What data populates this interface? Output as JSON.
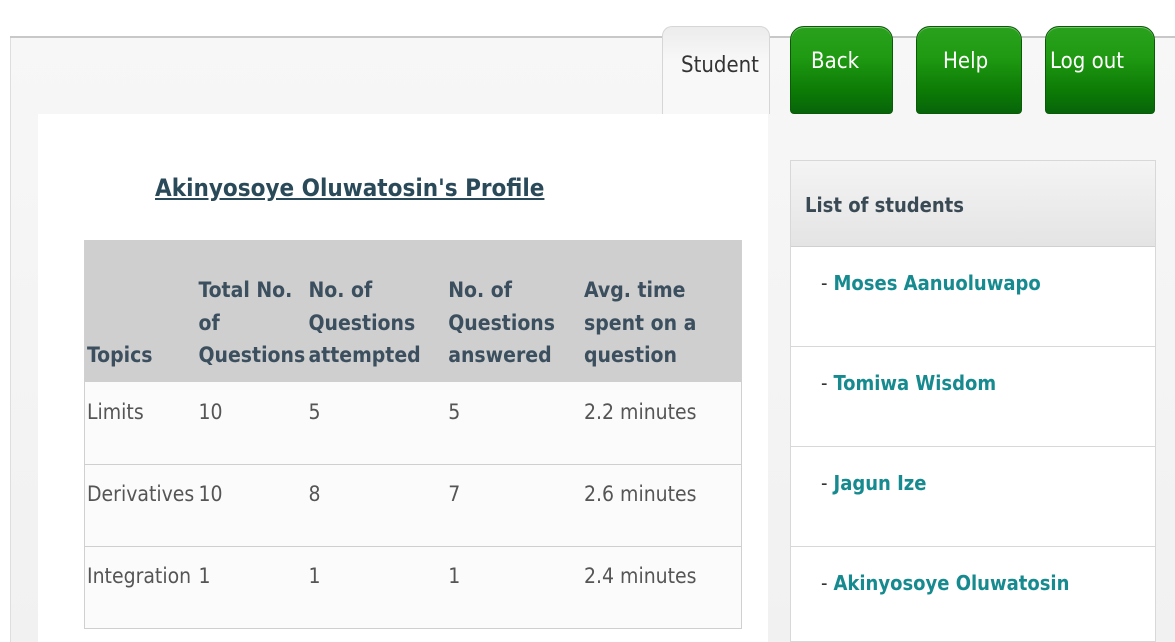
{
  "nav": {
    "student_tab": "Student",
    "back": "Back",
    "help": "Help",
    "logout": "Log out"
  },
  "profile": {
    "title": "Akinyosoye Oluwatosin's Profile"
  },
  "table": {
    "headers": [
      "Topics",
      "Total No. of Questions",
      "No. of Questions attempted",
      "No. of Questions answered",
      "Avg. time spent on a question"
    ],
    "rows": [
      [
        "Limits",
        "10",
        "5",
        "5",
        "2.2 minutes"
      ],
      [
        "Derivatives",
        "10",
        "8",
        "7",
        "2.6 minutes"
      ],
      [
        "Integration",
        "1",
        "1",
        "1",
        "2.4 minutes"
      ]
    ]
  },
  "sidebar": {
    "title": "List of students",
    "dash": "-",
    "students": [
      "Moses Aanuoluwapo",
      "Tomiwa Wisdom",
      "Jagun Ize",
      "Akinyosoye Oluwatosin"
    ]
  }
}
